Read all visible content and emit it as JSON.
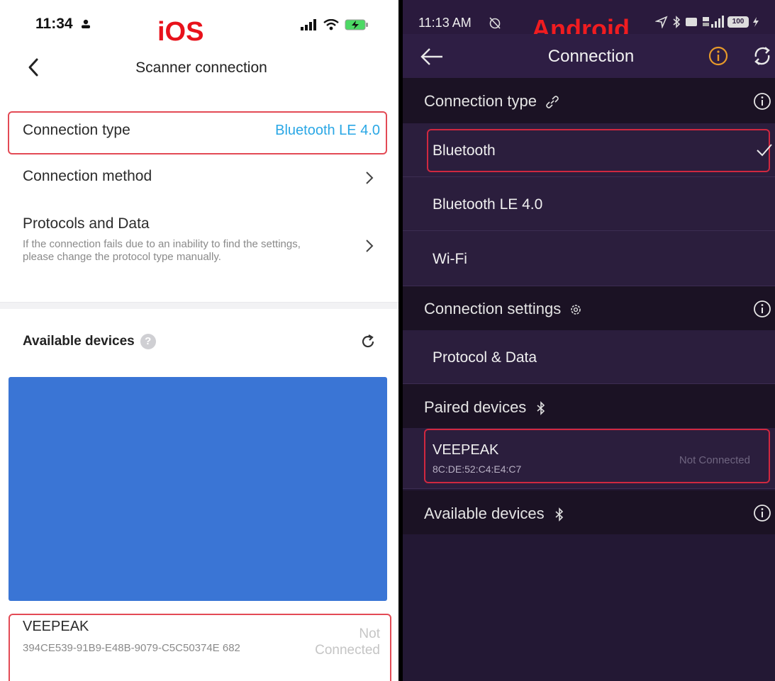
{
  "ios": {
    "status": {
      "time": "11:34"
    },
    "tag": "iOS",
    "title": "Scanner connection",
    "rows": {
      "connection_type": {
        "label": "Connection type",
        "value": "Bluetooth LE 4.0"
      },
      "connection_method": {
        "label": "Connection method"
      },
      "protocols": {
        "label": "Protocols and Data",
        "note": "If the connection fails due to an inability to find the settings, please change the protocol type manually."
      }
    },
    "available": {
      "label": "Available devices",
      "help": "?"
    },
    "device": {
      "name": "VEEPEAK",
      "id": "394CE539-91B9-E48B-9079-C5C50374E 682",
      "status": "Not Connected"
    },
    "colors": {
      "accent": "#2aa7e5",
      "highlight": "#e34a55",
      "placeholder": "#3a75d5"
    }
  },
  "android": {
    "status": {
      "time": "11:13 AM",
      "battery": "100"
    },
    "tag": "Android",
    "title": "Connection",
    "sections": {
      "connection_type": {
        "label": "Connection type"
      },
      "connection_settings": {
        "label": "Connection settings"
      },
      "paired": {
        "label": "Paired devices"
      },
      "available": {
        "label": "Available devices"
      }
    },
    "options": [
      "Bluetooth",
      "Bluetooth LE 4.0",
      "Wi-Fi"
    ],
    "selected_option": "Bluetooth",
    "protocol_item": "Protocol & Data",
    "paired_device": {
      "name": "VEEPEAK",
      "mac": "8C:DE:52:C4:E4:C7",
      "status": "Not Connected"
    },
    "colors": {
      "background": "#231834",
      "header": "#1b1224",
      "info_icon": "#e79a2a",
      "highlight": "#d02840"
    }
  }
}
